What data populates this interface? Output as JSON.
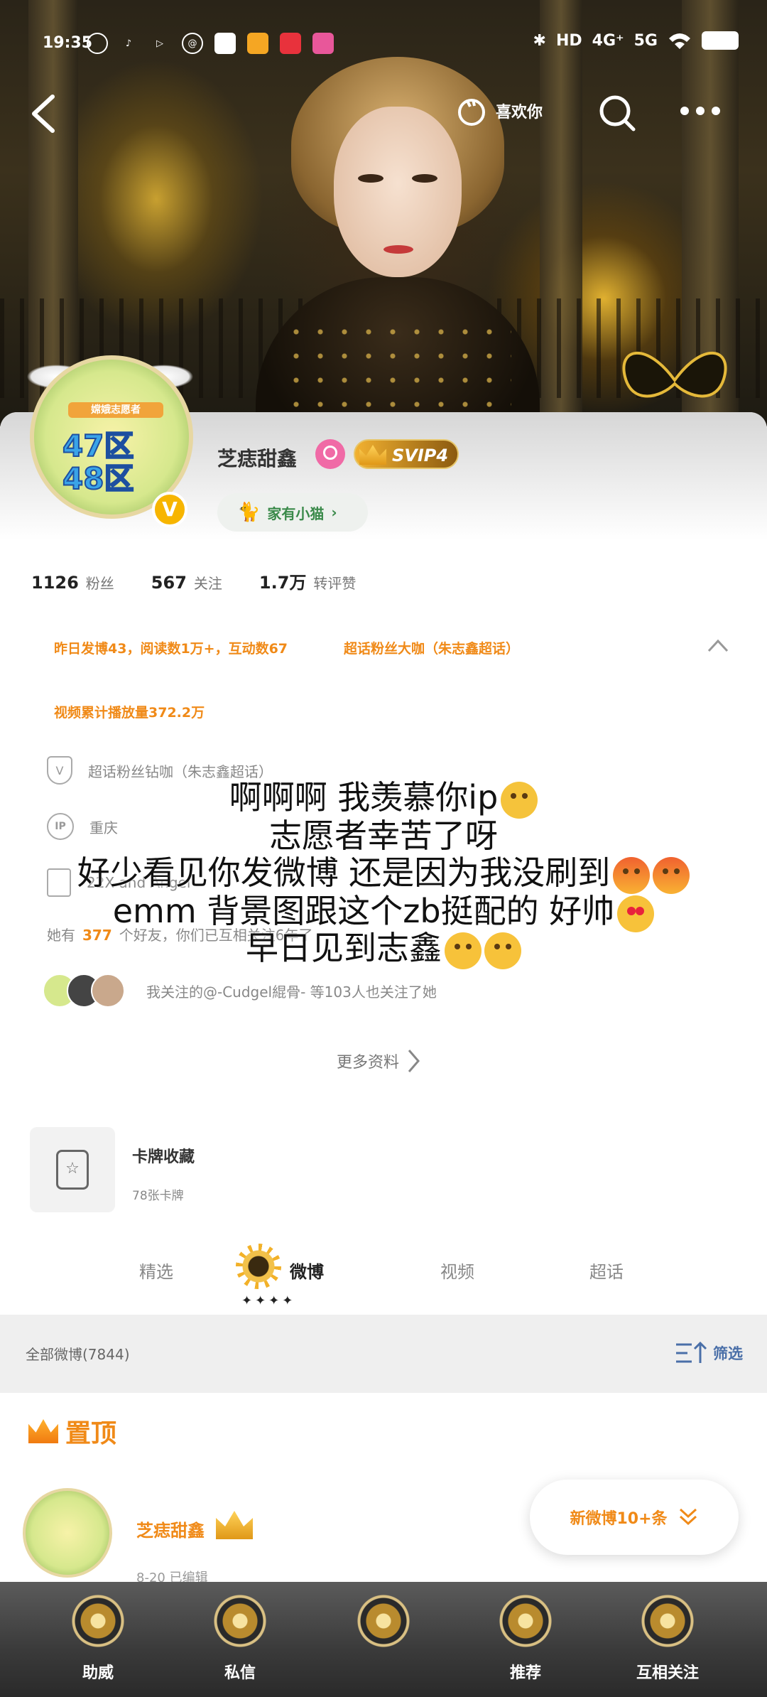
{
  "status_bar": {
    "time": "19:35",
    "right_items": [
      "HD",
      "4G⁺",
      "5G"
    ]
  },
  "top_nav": {
    "like_label": "喜欢你"
  },
  "profile": {
    "username": "芝痣甜鑫",
    "svip_label": "SVIP4",
    "cat_label": "家有小猫",
    "avatar_text": {
      "banner": "嫦娥志愿者",
      "line1": "47区",
      "line2": "48区"
    },
    "verified_badge": "V"
  },
  "stats": [
    {
      "num": "1126",
      "label": "粉丝"
    },
    {
      "num": "567",
      "label": "关注"
    },
    {
      "num": "1.7万",
      "label": "转评赞"
    }
  ],
  "highlights": {
    "line1": "昨日发博43，阅读数1万+，互动数67",
    "line2": "超话粉丝大咖（朱志鑫超话）",
    "line3": "视频累计播放量372.2万"
  },
  "info": {
    "super_topic": "超话粉丝钻咖（朱志鑫超话）",
    "ip_icon": "IP",
    "location": "重庆",
    "bio": "22X and Angel",
    "friends_prefix": "她有",
    "friends_count": "377",
    "friends_suffix": "个好友，你们已互相关注6年了",
    "mutual_text": "我关注的@-Cudgel緄骨-  等103人也关注了她"
  },
  "more_info": "更多资料",
  "card_collection": {
    "title": "卡牌收藏",
    "subtitle": "78张卡牌"
  },
  "tabs": {
    "t1": "精选",
    "t2": "微博",
    "t3": "视频",
    "t4": "超话",
    "stars": "✦✦✦✦"
  },
  "filter_bar": {
    "all_posts": "全部微博(7844)",
    "filter_label": "筛选"
  },
  "pinned": {
    "label": "置顶",
    "author": "芝痣甜鑫",
    "meta": "8-20  已编辑"
  },
  "new_posts_pill": "新微博10+条",
  "bottom_nav": [
    {
      "label": "助威"
    },
    {
      "label": "私信"
    },
    {
      "label": ""
    },
    {
      "label": "推荐"
    },
    {
      "label": "互相关注"
    }
  ],
  "danmaku": [
    "啊啊啊 我羡慕你ip",
    "志愿者幸苦了呀",
    "好少看见你发微博 还是因为我没刷到",
    "emm 背景图跟这个zb挺配的 好帅",
    "早日见到志鑫"
  ],
  "colors": {
    "accent_orange": "#f08a18",
    "filter_blue": "#4a6fa8",
    "svip_gold": "#f2b130"
  }
}
